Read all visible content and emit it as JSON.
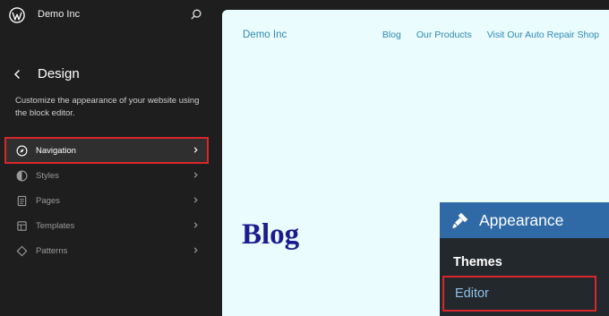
{
  "sidebar": {
    "site_name": "Demo Inc",
    "title": "Design",
    "description": "Customize the appearance of your website using the block editor.",
    "items": [
      {
        "label": "Navigation",
        "icon": "navigation-icon",
        "active": true
      },
      {
        "label": "Styles",
        "icon": "styles-icon",
        "active": false
      },
      {
        "label": "Pages",
        "icon": "pages-icon",
        "active": false
      },
      {
        "label": "Templates",
        "icon": "templates-icon",
        "active": false
      },
      {
        "label": "Patterns",
        "icon": "patterns-icon",
        "active": false
      }
    ]
  },
  "preview": {
    "site_name": "Demo Inc",
    "nav": [
      "Blog",
      "Our Products",
      "Visit Our Auto Repair Shop"
    ],
    "heading": "Blog"
  },
  "appearance_menu": {
    "title": "Appearance",
    "submenu_heading": "Themes",
    "highlighted_item": "Editor"
  },
  "colors": {
    "sidebar_bg": "#1e1e1e",
    "preview_bg": "#eafcfd",
    "link": "#2f89b4",
    "heading": "#1d1a8f",
    "highlight_border": "#d9262c",
    "appearance_header": "#2f6aa6"
  }
}
